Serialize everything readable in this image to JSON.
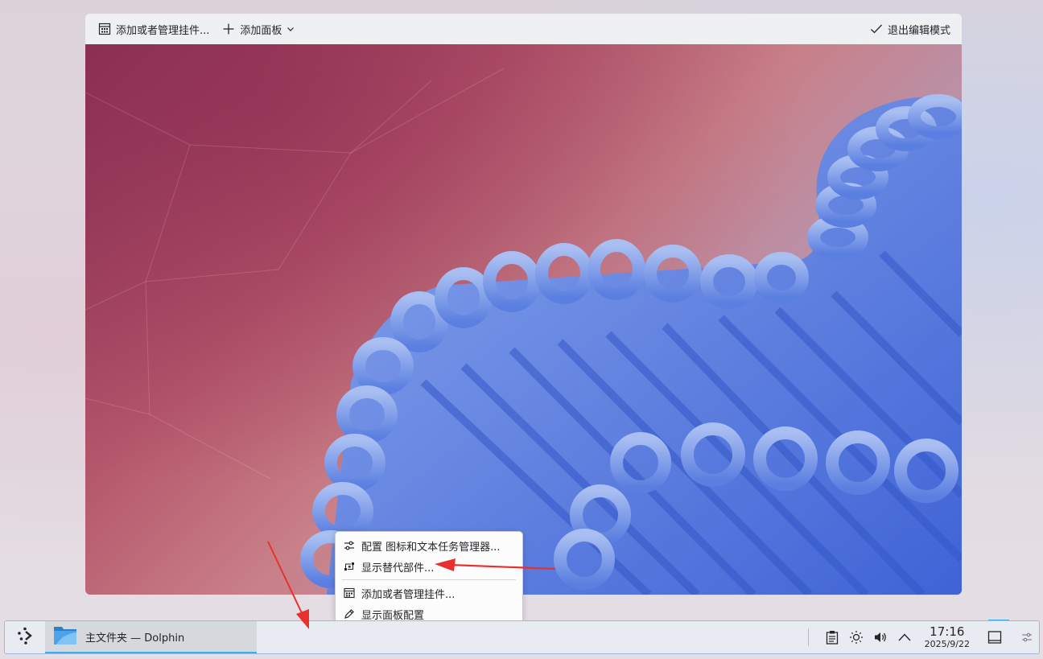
{
  "edit_toolbar": {
    "add_widgets_label": "添加或者管理挂件...",
    "add_panel_label": "添加面板",
    "exit_edit_label": "退出编辑模式"
  },
  "context_menu": {
    "items": [
      {
        "label": "配置 图标和文本任务管理器...",
        "icon": "configure-icon"
      },
      {
        "label": "显示替代部件...",
        "icon": "alternatives-icon"
      },
      {
        "label": "添加或者管理挂件...",
        "icon": "widgets-icon"
      },
      {
        "label": "显示面板配置",
        "icon": "edit-icon"
      }
    ]
  },
  "taskbar": {
    "task_label": "主文件夹 — Dolphin",
    "clock_time": "17:16",
    "clock_date": "2025/9/22"
  },
  "colors": {
    "accent": "#3daee9",
    "annotation_arrow": "#e8312f",
    "panel_bg": "#e8ebf1",
    "toolbar_bg": "#eff0f1"
  }
}
